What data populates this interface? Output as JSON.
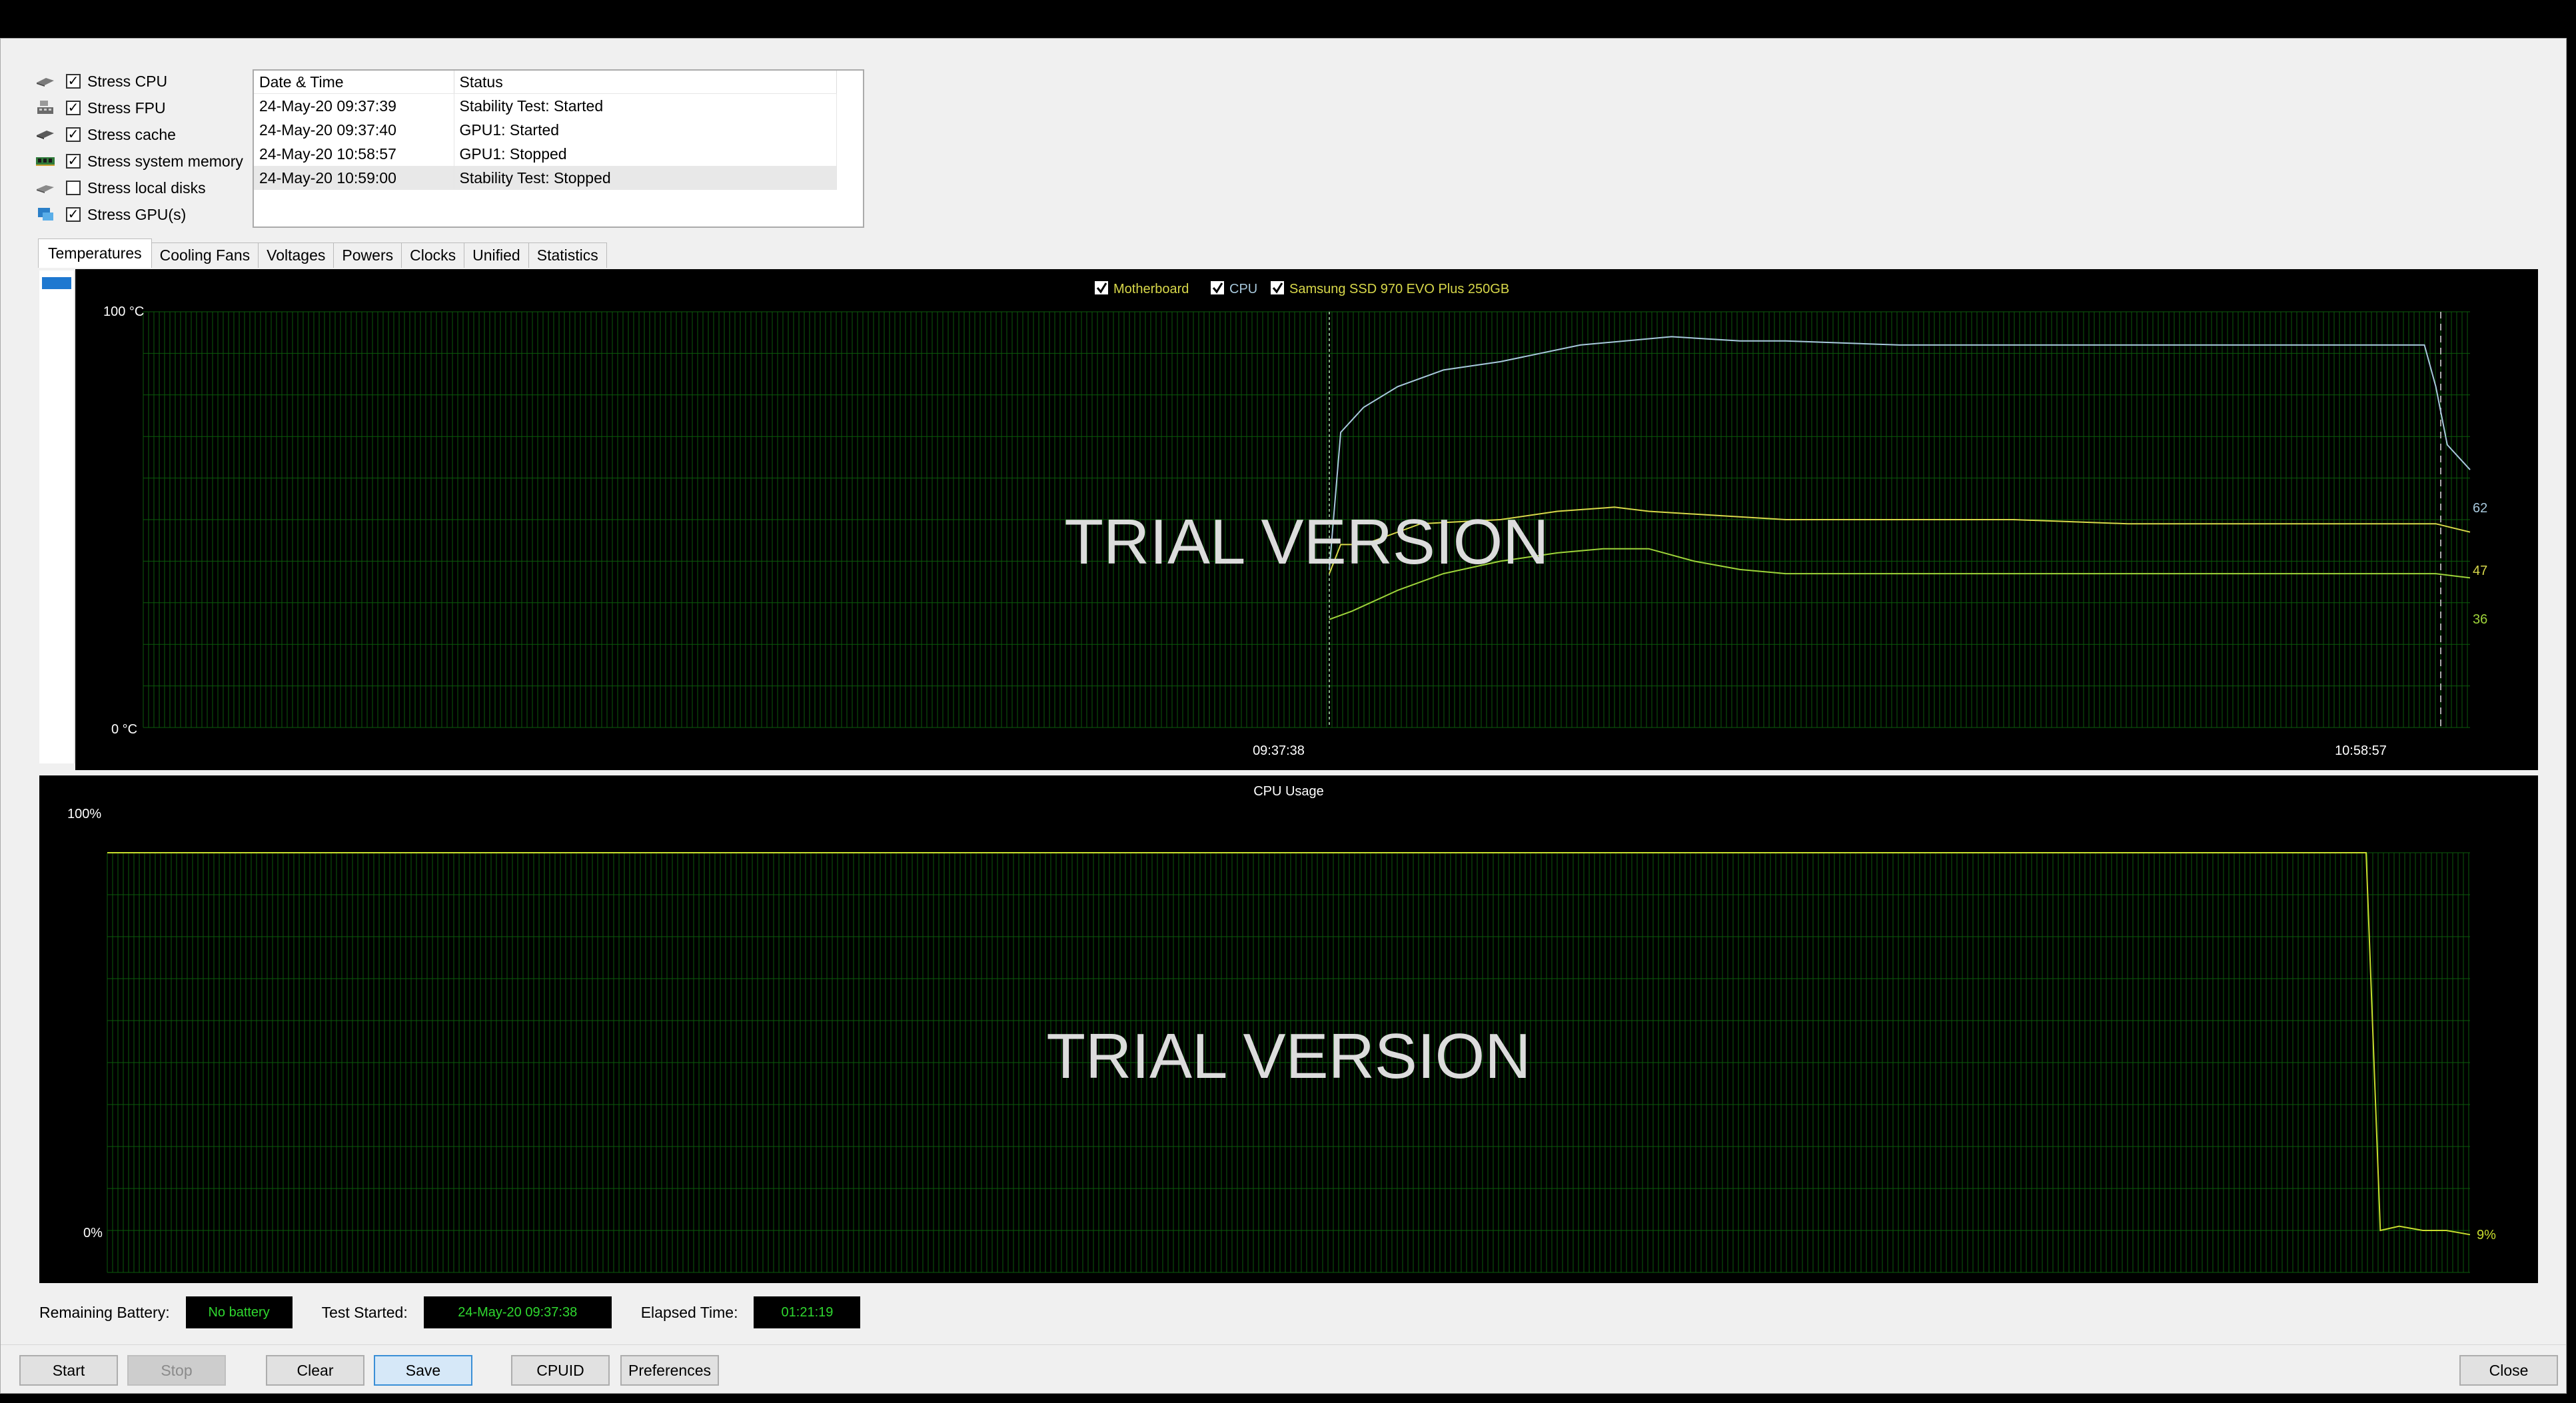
{
  "options": [
    {
      "label": "Stress CPU",
      "checked": true,
      "icon": "cpu-chip-icon"
    },
    {
      "label": "Stress FPU",
      "checked": true,
      "icon": "fpu-calc-icon"
    },
    {
      "label": "Stress cache",
      "checked": true,
      "icon": "cache-chip-icon"
    },
    {
      "label": "Stress system memory",
      "checked": true,
      "icon": "memory-stick-icon"
    },
    {
      "label": "Stress local disks",
      "checked": false,
      "icon": "hard-disk-icon"
    },
    {
      "label": "Stress GPU(s)",
      "checked": true,
      "icon": "gpu-monitor-icon"
    }
  ],
  "log": {
    "headers": {
      "datetime": "Date & Time",
      "status": "Status"
    },
    "rows": [
      {
        "datetime": "24-May-20 09:37:39",
        "status": "Stability Test: Started"
      },
      {
        "datetime": "24-May-20 09:37:40",
        "status": "GPU1: Started"
      },
      {
        "datetime": "24-May-20 10:58:57",
        "status": "GPU1: Stopped"
      },
      {
        "datetime": "24-May-20 10:59:00",
        "status": "Stability Test: Stopped"
      }
    ]
  },
  "tabs": [
    "Temperatures",
    "Cooling Fans",
    "Voltages",
    "Powers",
    "Clocks",
    "Unified",
    "Statistics"
  ],
  "active_tab": "Temperatures",
  "colors": {
    "grid": "#0b5a0b",
    "motherboard": "#d8d84a",
    "cpu_temp": "#a7c8dc",
    "ssd": "#9fd43a",
    "cpu_usage": "#c8dd2e",
    "status_value": "#2fd82f"
  },
  "temp_chart": {
    "legend": [
      {
        "label": "Motherboard",
        "checked": true
      },
      {
        "label": "CPU",
        "checked": true
      },
      {
        "label": "Samsung SSD 970 EVO Plus 250GB",
        "checked": true
      }
    ],
    "y_max_label": "100 °C",
    "y_min_label": "0 °C",
    "x_start_label": "09:37:38",
    "x_end_label": "10:58:57",
    "watermark": "TRIAL VERSION",
    "end_values": {
      "cpu": "62",
      "motherboard": "47",
      "ssd": "36"
    }
  },
  "usage_chart": {
    "title": "CPU Usage",
    "y_max_label": "100%",
    "y_min_label": "0%",
    "watermark": "TRIAL VERSION",
    "end_value": "9%"
  },
  "chart_data": [
    {
      "type": "line",
      "title": "",
      "xlabel": "",
      "ylabel": "",
      "ylim": [
        0,
        100
      ],
      "x_ticks": [
        "09:37:38",
        "10:58:57"
      ],
      "series": [
        {
          "name": "CPU",
          "points": [
            [
              0,
              38
            ],
            [
              1,
              71
            ],
            [
              3,
              77
            ],
            [
              6,
              82
            ],
            [
              10,
              86
            ],
            [
              15,
              88
            ],
            [
              22,
              92
            ],
            [
              30,
              94
            ],
            [
              36,
              93
            ],
            [
              40,
              93
            ],
            [
              50,
              92
            ],
            [
              60,
              92
            ],
            [
              70,
              92
            ],
            [
              80,
              92
            ],
            [
              90,
              92
            ],
            [
              96,
              92
            ],
            [
              97,
              82
            ],
            [
              98,
              68
            ],
            [
              100,
              62
            ]
          ]
        },
        {
          "name": "Motherboard",
          "points": [
            [
              0,
              37
            ],
            [
              1,
              44
            ],
            [
              3,
              44
            ],
            [
              8,
              49
            ],
            [
              15,
              50
            ],
            [
              20,
              52
            ],
            [
              25,
              53
            ],
            [
              28,
              52
            ],
            [
              34,
              51
            ],
            [
              40,
              50
            ],
            [
              50,
              50
            ],
            [
              60,
              50
            ],
            [
              70,
              49
            ],
            [
              80,
              49
            ],
            [
              90,
              49
            ],
            [
              97,
              49
            ],
            [
              100,
              47
            ]
          ]
        },
        {
          "name": "Samsung SSD 970 EVO Plus 250GB",
          "points": [
            [
              0,
              26
            ],
            [
              2,
              28
            ],
            [
              6,
              33
            ],
            [
              10,
              37
            ],
            [
              15,
              40
            ],
            [
              20,
              42
            ],
            [
              24,
              43
            ],
            [
              28,
              43
            ],
            [
              32,
              40
            ],
            [
              36,
              38
            ],
            [
              40,
              37
            ],
            [
              50,
              37
            ],
            [
              60,
              37
            ],
            [
              70,
              37
            ],
            [
              80,
              37
            ],
            [
              90,
              37
            ],
            [
              97,
              37
            ],
            [
              100,
              36
            ]
          ]
        }
      ]
    },
    {
      "type": "line",
      "title": "CPU Usage",
      "xlabel": "",
      "ylabel": "",
      "ylim": [
        0,
        100
      ],
      "series": [
        {
          "name": "CPU Usage",
          "points": [
            [
              0,
              100
            ],
            [
              10,
              100
            ],
            [
              20,
              100
            ],
            [
              30,
              100
            ],
            [
              40,
              100
            ],
            [
              50,
              100
            ],
            [
              60,
              100
            ],
            [
              70,
              100
            ],
            [
              80,
              100
            ],
            [
              90,
              100
            ],
            [
              95.6,
              100
            ],
            [
              96.2,
              10
            ],
            [
              97,
              11
            ],
            [
              98,
              10
            ],
            [
              99,
              10
            ],
            [
              100,
              9
            ]
          ]
        }
      ]
    }
  ],
  "status": {
    "battery_label": "Remaining Battery:",
    "battery_value": "No battery",
    "started_label": "Test Started:",
    "started_value": "24-May-20 09:37:38",
    "elapsed_label": "Elapsed Time:",
    "elapsed_value": "01:21:19"
  },
  "buttons": {
    "start": "Start",
    "stop": "Stop",
    "clear": "Clear",
    "save": "Save",
    "cpuid": "CPUID",
    "preferences": "Preferences",
    "close": "Close"
  }
}
